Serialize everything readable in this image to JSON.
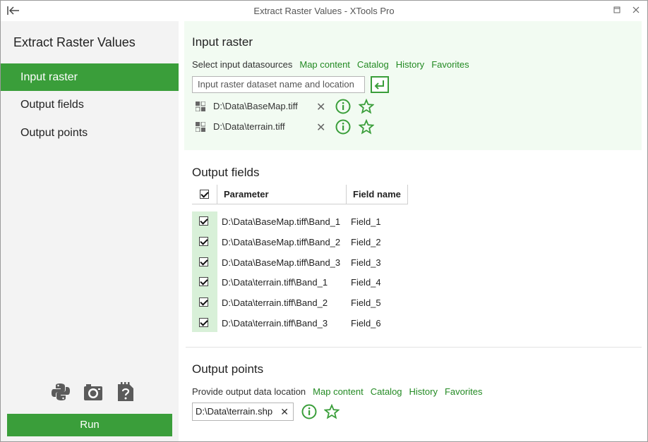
{
  "window": {
    "title": "Extract Raster Values - XTools Pro",
    "back_icon": "collapse-left-icon",
    "controls": [
      "restore-icon",
      "close-icon"
    ]
  },
  "sidebar": {
    "heading": "Extract Raster Values",
    "items": [
      {
        "label": "Input raster",
        "active": true
      },
      {
        "label": "Output fields",
        "active": false
      },
      {
        "label": "Output points",
        "active": false
      }
    ],
    "tool_icons": [
      "python-icon",
      "camera-icon",
      "help-doc-icon"
    ],
    "run_label": "Run"
  },
  "input_raster": {
    "title": "Input raster",
    "prompt": "Select input datasources",
    "links": [
      "Map content",
      "Catalog",
      "History",
      "Favorites"
    ],
    "input_placeholder": "Input raster dataset name and location",
    "datasources": [
      {
        "path": "D:\\Data\\BaseMap.tiff"
      },
      {
        "path": "D:\\Data\\terrain.tiff"
      }
    ]
  },
  "output_fields": {
    "title": "Output fields",
    "headers": {
      "parameter": "Parameter",
      "field_name": "Field name"
    },
    "rows": [
      {
        "parameter": "D:\\Data\\BaseMap.tiff\\Band_1",
        "field": "Field_1",
        "checked": true
      },
      {
        "parameter": "D:\\Data\\BaseMap.tiff\\Band_2",
        "field": "Field_2",
        "checked": true
      },
      {
        "parameter": "D:\\Data\\BaseMap.tiff\\Band_3",
        "field": "Field_3",
        "checked": true
      },
      {
        "parameter": "D:\\Data\\terrain.tiff\\Band_1",
        "field": "Field_4",
        "checked": true
      },
      {
        "parameter": "D:\\Data\\terrain.tiff\\Band_2",
        "field": "Field_5",
        "checked": true
      },
      {
        "parameter": "D:\\Data\\terrain.tiff\\Band_3",
        "field": "Field_6",
        "checked": true
      }
    ]
  },
  "output_points": {
    "title": "Output points",
    "prompt": "Provide output data location",
    "links": [
      "Map content",
      "Catalog",
      "History",
      "Favorites"
    ],
    "path": "D:\\Data\\terrain.shp",
    "clear_glyph": "✕"
  },
  "colors": {
    "accent": "#3a9e3a",
    "link": "#238a23",
    "panel_tint": "#f2fbf2",
    "sidebar_bg": "#f3f3f3"
  }
}
